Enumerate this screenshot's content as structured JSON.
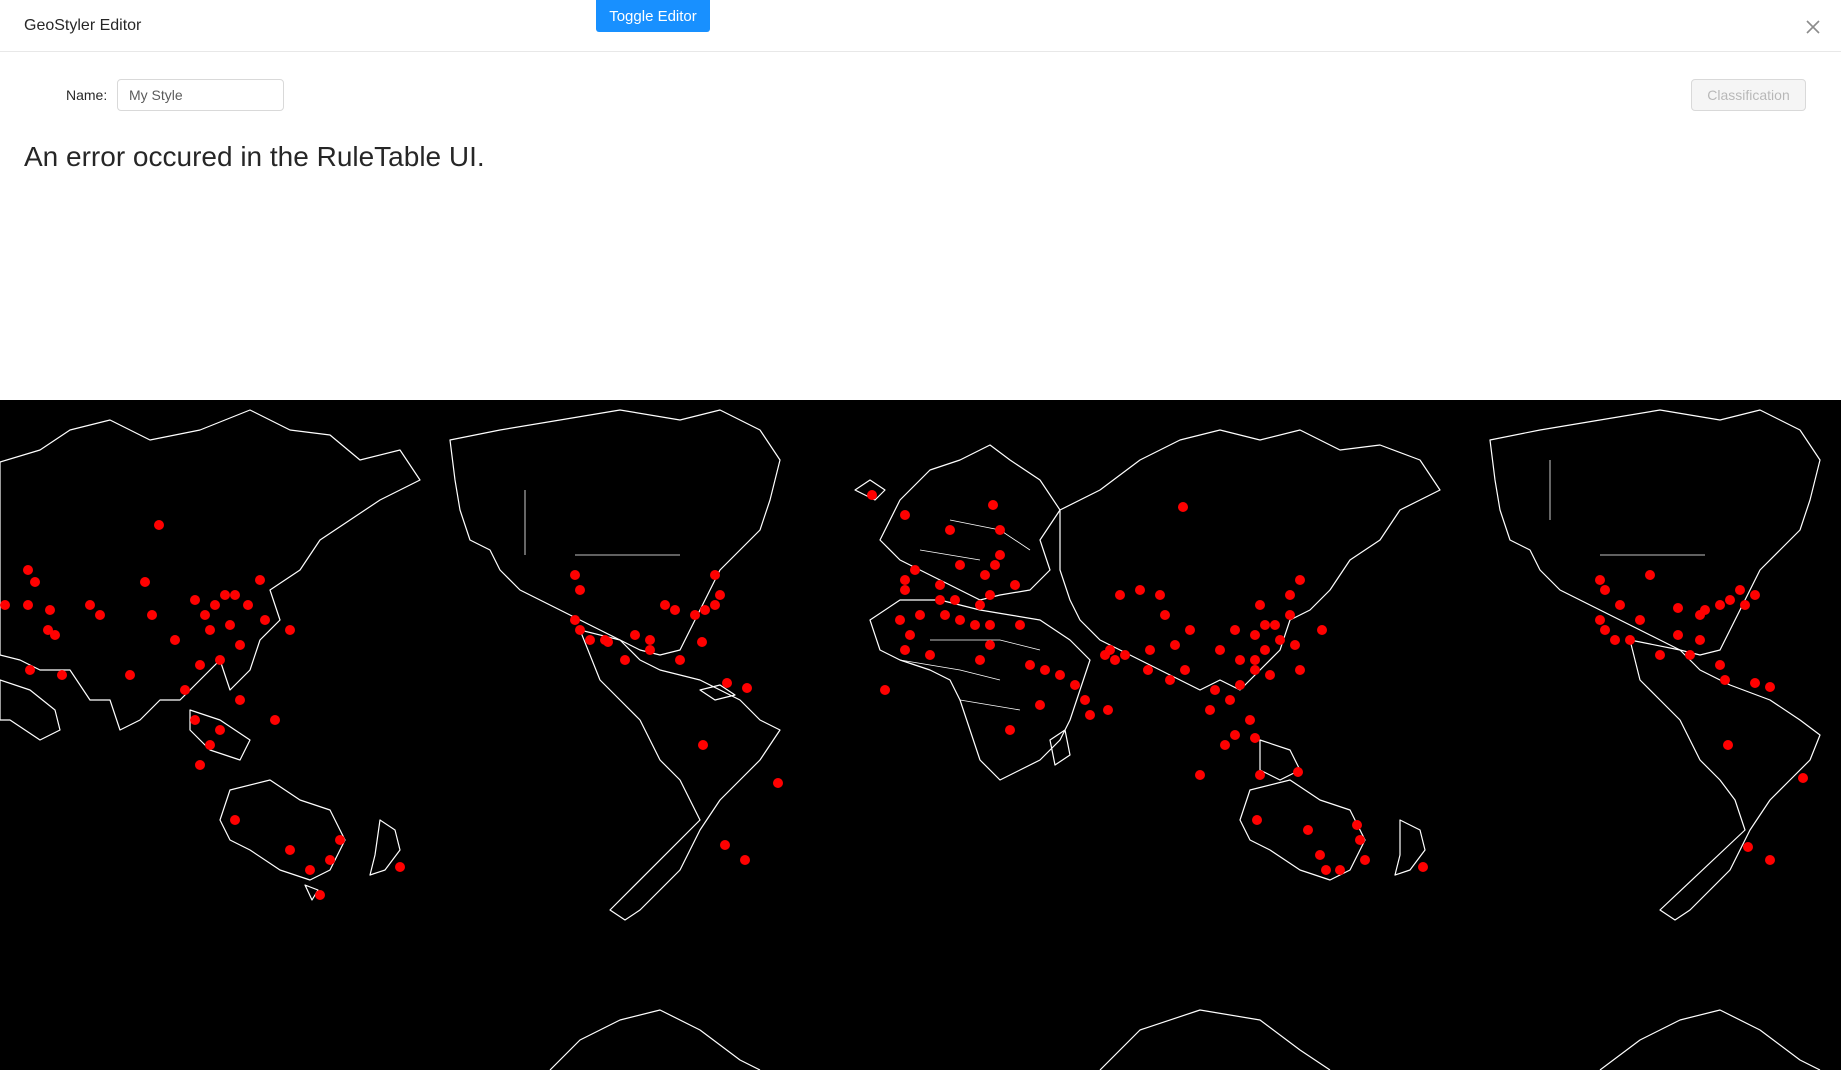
{
  "modal": {
    "title": "GeoStyler Editor",
    "close_icon": "close-icon"
  },
  "toolbar": {
    "toggle_label": "Toggle Editor"
  },
  "style_form": {
    "name_label": "Name",
    "name_value": "My Style",
    "classification_label": "Classification"
  },
  "error": {
    "message": "An error occured in the RuleTable UI."
  },
  "map": {
    "background_color": "#000000",
    "coastline_color": "#ffffff",
    "point_color": "#ff0000"
  }
}
